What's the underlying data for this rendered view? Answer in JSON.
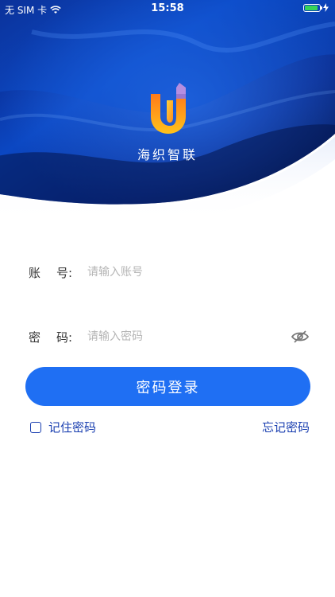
{
  "status_bar": {
    "carrier": "无 SIM 卡",
    "time": "15:58",
    "icons": [
      "wifi-icon",
      "battery-icon",
      "charging-icon"
    ]
  },
  "brand": {
    "app_name": "海织智联",
    "logo_icon": "app-logo-u-icon"
  },
  "form": {
    "account_label_a": "账",
    "account_label_b": "号:",
    "account_placeholder": "请输入账号",
    "password_label_a": "密",
    "password_label_b": "码:",
    "password_placeholder": "请输入密码",
    "password_toggle_icon": "eye-hidden-icon",
    "login_button": "密码登录",
    "remember_label": "记住密码",
    "forgot_label": "忘记密码"
  },
  "colors": {
    "primary": "#1f6ff3",
    "link": "#1a3fb0",
    "hero_dark": "#04103e",
    "hero_mid": "#0b3fb3"
  }
}
